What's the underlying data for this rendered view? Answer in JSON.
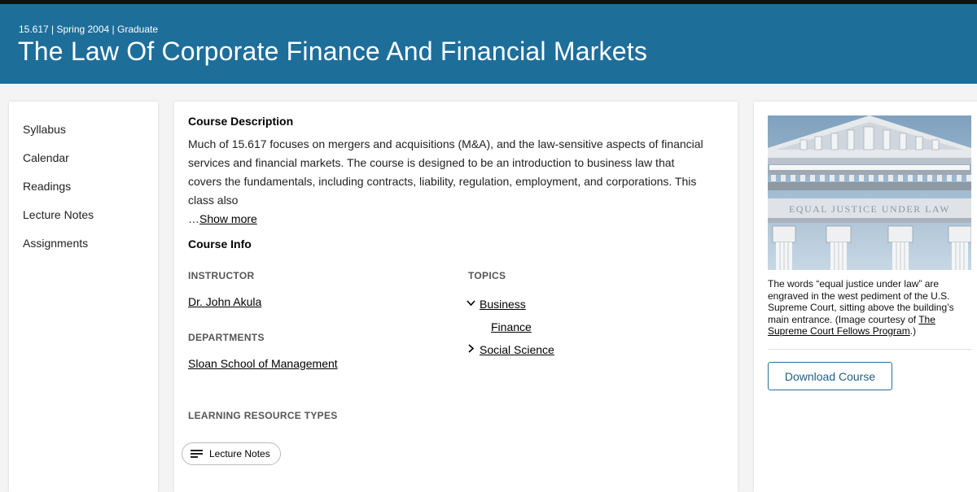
{
  "header": {
    "meta": "15.617 | Spring 2004 | Graduate",
    "title": "The Law Of Corporate Finance And Financial Markets"
  },
  "sidebar": {
    "items": [
      {
        "label": "Syllabus"
      },
      {
        "label": "Calendar"
      },
      {
        "label": "Readings"
      },
      {
        "label": "Lecture Notes"
      },
      {
        "label": "Assignments"
      }
    ]
  },
  "description": {
    "heading": "Course Description",
    "text": "Much of 15.617 focuses on mergers and acquisitions (M&A), and the law-sensitive aspects of financial services and financial markets. The course is designed to be an introduction to business law that covers the fundamentals, including contracts, liability, regulation, employment, and corporations. This class also",
    "ellipsis": "…",
    "show_more": "Show more"
  },
  "course_info": {
    "heading": "Course Info",
    "instructor_label": "INSTRUCTOR",
    "instructor": "Dr. John Akula",
    "departments_label": "DEPARTMENTS",
    "department": "Sloan School of Management",
    "topics_label": "TOPICS",
    "topics": {
      "business": "Business",
      "finance": "Finance",
      "social_science": "Social Science"
    },
    "resource_types_label": "LEARNING RESOURCE TYPES",
    "resource_chip": "Lecture Notes"
  },
  "aside": {
    "image_inscription": "EQUAL JUSTICE UNDER LAW",
    "caption_prefix": "The words “equal justice under law” are engraved in the west pediment of the U.S. Supreme Court, sitting above the building’s main entrance. (Image courtesy of ",
    "caption_link": "The Supreme Court Fellows Program",
    "caption_suffix": ".)",
    "download_label": "Download Course"
  },
  "colors": {
    "header_bg": "#1e6e9a",
    "button_border": "#2a6f97"
  }
}
